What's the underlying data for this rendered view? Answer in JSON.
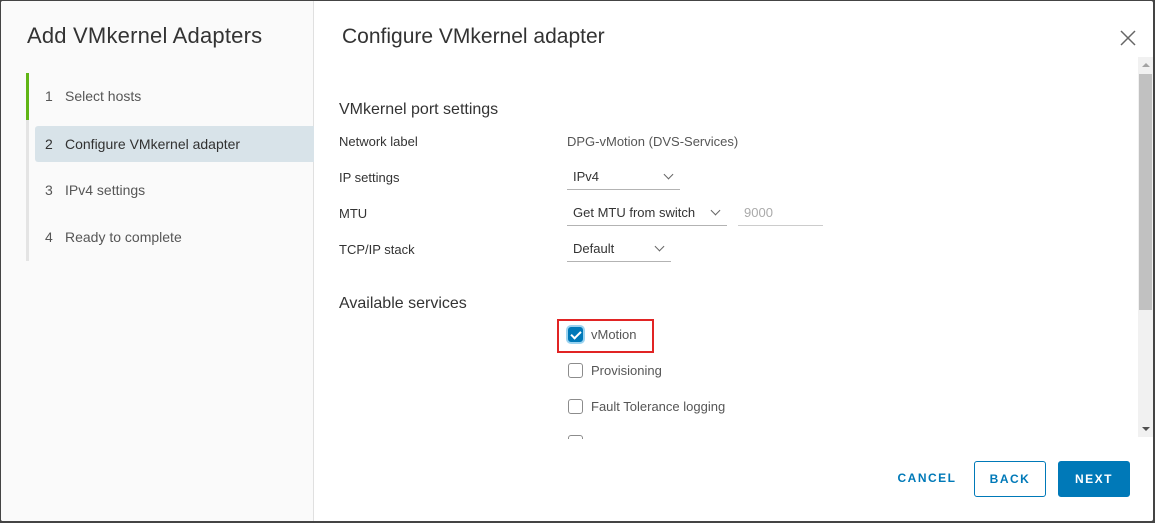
{
  "wizard": {
    "title": "Add VMkernel Adapters",
    "steps": [
      {
        "num": "1",
        "label": "Select hosts",
        "state": "done"
      },
      {
        "num": "2",
        "label": "Configure VMkernel adapter",
        "state": "active"
      },
      {
        "num": "3",
        "label": "IPv4 settings",
        "state": "pending"
      },
      {
        "num": "4",
        "label": "Ready to complete",
        "state": "pending"
      }
    ]
  },
  "page": {
    "title": "Configure VMkernel adapter",
    "port_settings": {
      "heading": "VMkernel port settings",
      "network_label": {
        "label": "Network label",
        "value": "DPG-vMotion (DVS-Services)"
      },
      "ip_settings": {
        "label": "IP settings",
        "value": "IPv4"
      },
      "mtu": {
        "label": "MTU",
        "value": "Get MTU from switch",
        "number": "9000"
      },
      "tcpip": {
        "label": "TCP/IP stack",
        "value": "Default"
      }
    },
    "services": {
      "heading": "Available services",
      "items": [
        {
          "label": "vMotion",
          "checked": true
        },
        {
          "label": "Provisioning",
          "checked": false
        },
        {
          "label": "Fault Tolerance logging",
          "checked": false
        },
        {
          "label": "",
          "checked": false
        }
      ]
    }
  },
  "footer": {
    "cancel": "CANCEL",
    "back": "BACK",
    "next": "NEXT"
  },
  "colors": {
    "accent": "#0079b8",
    "done": "#60b515",
    "highlight": "#e12424"
  }
}
